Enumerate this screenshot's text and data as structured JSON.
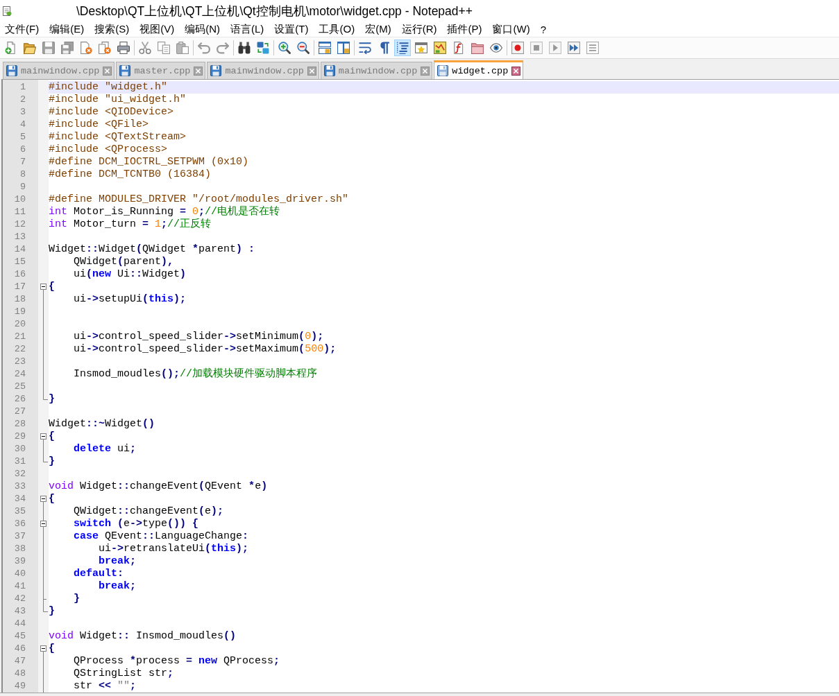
{
  "window": {
    "title": "\\Desktop\\QT上位机\\QT上位机\\Qt控制电机\\motor\\widget.cpp - Notepad++"
  },
  "menu": [
    "文件(F)",
    "编辑(E)",
    "搜索(S)",
    "视图(V)",
    "编码(N)",
    "语言(L)",
    "设置(T)",
    "工具(O)",
    "宏(M)",
    "运行(R)",
    "插件(P)",
    "窗口(W)",
    "?"
  ],
  "toolbar": [
    {
      "kind": "new-file",
      "pressed": false,
      "disabled": false
    },
    {
      "kind": "open",
      "pressed": false,
      "disabled": false
    },
    {
      "kind": "save",
      "pressed": false,
      "disabled": true
    },
    {
      "kind": "save-all",
      "pressed": false,
      "disabled": true
    },
    {
      "kind": "close",
      "pressed": false,
      "disabled": false
    },
    {
      "kind": "close-all",
      "pressed": false,
      "disabled": false
    },
    {
      "kind": "print",
      "pressed": false,
      "disabled": false
    },
    {
      "kind": "separator"
    },
    {
      "kind": "cut",
      "pressed": false,
      "disabled": true
    },
    {
      "kind": "copy",
      "pressed": false,
      "disabled": true
    },
    {
      "kind": "paste",
      "pressed": false,
      "disabled": true
    },
    {
      "kind": "separator"
    },
    {
      "kind": "undo",
      "pressed": false,
      "disabled": true
    },
    {
      "kind": "redo",
      "pressed": false,
      "disabled": true
    },
    {
      "kind": "separator"
    },
    {
      "kind": "find",
      "pressed": false,
      "disabled": false
    },
    {
      "kind": "replace",
      "pressed": false,
      "disabled": false
    },
    {
      "kind": "separator"
    },
    {
      "kind": "zoom-in",
      "pressed": false,
      "disabled": false
    },
    {
      "kind": "zoom-out",
      "pressed": false,
      "disabled": false
    },
    {
      "kind": "separator"
    },
    {
      "kind": "sync-vertical",
      "pressed": false,
      "disabled": false
    },
    {
      "kind": "sync-horizontal",
      "pressed": false,
      "disabled": false
    },
    {
      "kind": "separator"
    },
    {
      "kind": "word-wrap",
      "pressed": false,
      "disabled": false
    },
    {
      "kind": "show-all",
      "pressed": false,
      "disabled": false
    },
    {
      "kind": "indent-guide",
      "pressed": true,
      "disabled": false
    },
    {
      "kind": "user-language",
      "pressed": false,
      "disabled": false
    },
    {
      "kind": "document-map",
      "pressed": false,
      "disabled": false
    },
    {
      "kind": "function-list",
      "pressed": false,
      "disabled": false
    },
    {
      "kind": "folder-workspace",
      "pressed": false,
      "disabled": false
    },
    {
      "kind": "monitoring",
      "pressed": false,
      "disabled": false
    },
    {
      "kind": "separator"
    },
    {
      "kind": "record",
      "pressed": false,
      "disabled": false
    },
    {
      "kind": "stop",
      "pressed": false,
      "disabled": true
    },
    {
      "kind": "play",
      "pressed": false,
      "disabled": true
    },
    {
      "kind": "play-multiple",
      "pressed": false,
      "disabled": false
    },
    {
      "kind": "save-macro",
      "pressed": false,
      "disabled": true
    }
  ],
  "tabs": [
    {
      "label": "mainwindow.cpp",
      "selected": false
    },
    {
      "label": "master.cpp",
      "selected": false
    },
    {
      "label": "mainwindow.cpp",
      "selected": false
    },
    {
      "label": "mainwindow.cpp",
      "selected": false
    },
    {
      "label": "widget.cpp",
      "selected": true
    }
  ],
  "editor": {
    "lines": [
      {
        "number": "1",
        "current": true,
        "tokens": [
          {
            "kind": "pre",
            "text": "#include \"widget.h\""
          }
        ]
      },
      {
        "number": "2",
        "current": false,
        "tokens": [
          {
            "kind": "pre",
            "text": "#include \"ui_widget.h\""
          }
        ]
      },
      {
        "number": "3",
        "current": false,
        "tokens": [
          {
            "kind": "pre",
            "text": "#include <QIODevice>"
          }
        ]
      },
      {
        "number": "4",
        "current": false,
        "tokens": [
          {
            "kind": "pre",
            "text": "#include <QFile>"
          }
        ]
      },
      {
        "number": "5",
        "current": false,
        "tokens": [
          {
            "kind": "pre",
            "text": "#include <QTextStream>"
          }
        ]
      },
      {
        "number": "6",
        "current": false,
        "tokens": [
          {
            "kind": "pre",
            "text": "#include <QProcess>"
          }
        ]
      },
      {
        "number": "7",
        "current": false,
        "tokens": [
          {
            "kind": "pre",
            "text": "#define DCM_IOCTRL_SETPWM (0x10)"
          }
        ]
      },
      {
        "number": "8",
        "current": false,
        "tokens": [
          {
            "kind": "pre",
            "text": "#define DCM_TCNTB0 (16384)"
          }
        ]
      },
      {
        "number": "9",
        "current": false
      },
      {
        "number": "10",
        "current": false,
        "tokens": [
          {
            "kind": "pre",
            "text": "#define MODULES_DRIVER \"/root/modules_driver.sh\""
          }
        ]
      },
      {
        "number": "11",
        "current": false,
        "tokens": [
          {
            "kind": "type",
            "text": "int"
          },
          {
            "kind": "plain",
            "text": " Motor_is_Running "
          },
          {
            "kind": "operator",
            "text": "= "
          },
          {
            "kind": "number",
            "text": "0"
          },
          {
            "kind": "operator",
            "text": ";"
          },
          {
            "kind": "comment",
            "text": "//电机是否在转"
          }
        ]
      },
      {
        "number": "12",
        "current": false,
        "tokens": [
          {
            "kind": "type",
            "text": "int"
          },
          {
            "kind": "plain",
            "text": " Motor_turn "
          },
          {
            "kind": "operator",
            "text": "= "
          },
          {
            "kind": "number",
            "text": "1"
          },
          {
            "kind": "operator",
            "text": ";"
          },
          {
            "kind": "comment",
            "text": "//正反转"
          }
        ]
      },
      {
        "number": "13",
        "current": false
      },
      {
        "number": "14",
        "current": false,
        "tokens": [
          {
            "kind": "plain",
            "text": "Widget"
          },
          {
            "kind": "operator",
            "text": "::"
          },
          {
            "kind": "plain",
            "text": "Widget"
          },
          {
            "kind": "operator",
            "text": "("
          },
          {
            "kind": "plain",
            "text": "QWidget "
          },
          {
            "kind": "operator",
            "text": "*"
          },
          {
            "kind": "plain",
            "text": "parent"
          },
          {
            "kind": "operator",
            "text": ") :"
          }
        ]
      },
      {
        "number": "15",
        "current": false,
        "tokens": [
          {
            "kind": "plain",
            "text": "    QWidget"
          },
          {
            "kind": "operator",
            "text": "("
          },
          {
            "kind": "plain",
            "text": "parent"
          },
          {
            "kind": "operator",
            "text": "),"
          }
        ]
      },
      {
        "number": "16",
        "current": false,
        "tokens": [
          {
            "kind": "plain",
            "text": "    ui"
          },
          {
            "kind": "operator",
            "text": "("
          },
          {
            "kind": "keyword",
            "text": "new"
          },
          {
            "kind": "plain",
            "text": " Ui"
          },
          {
            "kind": "operator",
            "text": "::"
          },
          {
            "kind": "plain",
            "text": "Widget"
          },
          {
            "kind": "operator",
            "text": ")"
          }
        ]
      },
      {
        "number": "17",
        "current": false,
        "fold": {
          "kind": "expanded"
        },
        "tokens": [
          {
            "kind": "operator",
            "text": "{"
          }
        ]
      },
      {
        "number": "18",
        "current": false,
        "fold": {
          "kind": "line"
        },
        "tokens": [
          {
            "kind": "plain",
            "text": "    ui"
          },
          {
            "kind": "operator",
            "text": "->"
          },
          {
            "kind": "plain",
            "text": "setupUi"
          },
          {
            "kind": "operator",
            "text": "("
          },
          {
            "kind": "keyword",
            "text": "this"
          },
          {
            "kind": "operator",
            "text": ");"
          }
        ]
      },
      {
        "number": "19",
        "current": false,
        "fold": {
          "kind": "line"
        }
      },
      {
        "number": "20",
        "current": false,
        "fold": {
          "kind": "line"
        }
      },
      {
        "number": "21",
        "current": false,
        "fold": {
          "kind": "line"
        },
        "tokens": [
          {
            "kind": "plain",
            "text": "    ui"
          },
          {
            "kind": "operator",
            "text": "->"
          },
          {
            "kind": "plain",
            "text": "control_speed_slider"
          },
          {
            "kind": "operator",
            "text": "->"
          },
          {
            "kind": "plain",
            "text": "setMinimum"
          },
          {
            "kind": "operator",
            "text": "("
          },
          {
            "kind": "number",
            "text": "0"
          },
          {
            "kind": "operator",
            "text": ");"
          }
        ]
      },
      {
        "number": "22",
        "current": false,
        "fold": {
          "kind": "line"
        },
        "tokens": [
          {
            "kind": "plain",
            "text": "    ui"
          },
          {
            "kind": "operator",
            "text": "->"
          },
          {
            "kind": "plain",
            "text": "control_speed_slider"
          },
          {
            "kind": "operator",
            "text": "->"
          },
          {
            "kind": "plain",
            "text": "setMaximum"
          },
          {
            "kind": "operator",
            "text": "("
          },
          {
            "kind": "number",
            "text": "500"
          },
          {
            "kind": "operator",
            "text": ");"
          }
        ]
      },
      {
        "number": "23",
        "current": false,
        "fold": {
          "kind": "line"
        }
      },
      {
        "number": "24",
        "current": false,
        "fold": {
          "kind": "line"
        },
        "tokens": [
          {
            "kind": "plain",
            "text": "    Insmod_moudles"
          },
          {
            "kind": "operator",
            "text": "();"
          },
          {
            "kind": "comment",
            "text": "//加载模块硬件驱动脚本程序"
          }
        ]
      },
      {
        "number": "25",
        "current": false,
        "fold": {
          "kind": "line"
        }
      },
      {
        "number": "26",
        "current": false,
        "fold": {
          "kind": "end"
        },
        "tokens": [
          {
            "kind": "operator",
            "text": "}"
          }
        ]
      },
      {
        "number": "27",
        "current": false
      },
      {
        "number": "28",
        "current": false,
        "tokens": [
          {
            "kind": "plain",
            "text": "Widget"
          },
          {
            "kind": "operator",
            "text": "::~"
          },
          {
            "kind": "plain",
            "text": "Widget"
          },
          {
            "kind": "operator",
            "text": "()"
          }
        ]
      },
      {
        "number": "29",
        "current": false,
        "fold": {
          "kind": "expanded"
        },
        "tokens": [
          {
            "kind": "operator",
            "text": "{"
          }
        ]
      },
      {
        "number": "30",
        "current": false,
        "fold": {
          "kind": "line"
        },
        "tokens": [
          {
            "kind": "keyword",
            "text": "    delete"
          },
          {
            "kind": "plain",
            "text": " ui"
          },
          {
            "kind": "operator",
            "text": ";"
          }
        ]
      },
      {
        "number": "31",
        "current": false,
        "fold": {
          "kind": "end"
        },
        "tokens": [
          {
            "kind": "operator",
            "text": "}"
          }
        ]
      },
      {
        "number": "32",
        "current": false
      },
      {
        "number": "33",
        "current": false,
        "tokens": [
          {
            "kind": "type",
            "text": "void"
          },
          {
            "kind": "plain",
            "text": " Widget"
          },
          {
            "kind": "operator",
            "text": "::"
          },
          {
            "kind": "plain",
            "text": "changeEvent"
          },
          {
            "kind": "operator",
            "text": "("
          },
          {
            "kind": "plain",
            "text": "QEvent "
          },
          {
            "kind": "operator",
            "text": "*"
          },
          {
            "kind": "plain",
            "text": "e"
          },
          {
            "kind": "operator",
            "text": ")"
          }
        ]
      },
      {
        "number": "34",
        "current": false,
        "fold": {
          "kind": "expanded"
        },
        "tokens": [
          {
            "kind": "operator",
            "text": "{"
          }
        ]
      },
      {
        "number": "35",
        "current": false,
        "fold": {
          "kind": "line"
        },
        "tokens": [
          {
            "kind": "plain",
            "text": "    QWidget"
          },
          {
            "kind": "operator",
            "text": "::"
          },
          {
            "kind": "plain",
            "text": "changeEvent"
          },
          {
            "kind": "operator",
            "text": "("
          },
          {
            "kind": "plain",
            "text": "e"
          },
          {
            "kind": "operator",
            "text": ");"
          }
        ]
      },
      {
        "number": "36",
        "current": false,
        "fold": {
          "kind": "expanded"
        },
        "tokens": [
          {
            "kind": "keyword",
            "text": "    switch"
          },
          {
            "kind": "operator",
            "text": " ("
          },
          {
            "kind": "plain",
            "text": "e"
          },
          {
            "kind": "operator",
            "text": "->"
          },
          {
            "kind": "plain",
            "text": "type"
          },
          {
            "kind": "operator",
            "text": "()) {"
          }
        ]
      },
      {
        "number": "37",
        "current": false,
        "fold": {
          "kind": "line"
        },
        "tokens": [
          {
            "kind": "keyword",
            "text": "    case"
          },
          {
            "kind": "plain",
            "text": " QEvent"
          },
          {
            "kind": "operator",
            "text": "::"
          },
          {
            "kind": "plain",
            "text": "LanguageChange"
          },
          {
            "kind": "operator",
            "text": ":"
          }
        ]
      },
      {
        "number": "38",
        "current": false,
        "fold": {
          "kind": "line"
        },
        "tokens": [
          {
            "kind": "plain",
            "text": "        ui"
          },
          {
            "kind": "operator",
            "text": "->"
          },
          {
            "kind": "plain",
            "text": "retranslateUi"
          },
          {
            "kind": "operator",
            "text": "("
          },
          {
            "kind": "keyword",
            "text": "this"
          },
          {
            "kind": "operator",
            "text": ");"
          }
        ]
      },
      {
        "number": "39",
        "current": false,
        "fold": {
          "kind": "line"
        },
        "tokens": [
          {
            "kind": "keyword",
            "text": "        break"
          },
          {
            "kind": "operator",
            "text": ";"
          }
        ]
      },
      {
        "number": "40",
        "current": false,
        "fold": {
          "kind": "line"
        },
        "tokens": [
          {
            "kind": "keyword",
            "text": "    default"
          },
          {
            "kind": "operator",
            "text": ":"
          }
        ]
      },
      {
        "number": "41",
        "current": false,
        "fold": {
          "kind": "line"
        },
        "tokens": [
          {
            "kind": "keyword",
            "text": "        break"
          },
          {
            "kind": "operator",
            "text": ";"
          }
        ]
      },
      {
        "number": "42",
        "current": false,
        "fold": {
          "kind": "tee"
        },
        "tokens": [
          {
            "kind": "operator",
            "text": "    }"
          }
        ]
      },
      {
        "number": "43",
        "current": false,
        "fold": {
          "kind": "end"
        },
        "tokens": [
          {
            "kind": "operator",
            "text": "}"
          }
        ]
      },
      {
        "number": "44",
        "current": false
      },
      {
        "number": "45",
        "current": false,
        "tokens": [
          {
            "kind": "type",
            "text": "void"
          },
          {
            "kind": "plain",
            "text": " Widget"
          },
          {
            "kind": "operator",
            "text": "::"
          },
          {
            "kind": "plain",
            "text": " Insmod_moudles"
          },
          {
            "kind": "operator",
            "text": "()"
          }
        ]
      },
      {
        "number": "46",
        "current": false,
        "fold": {
          "kind": "expanded"
        },
        "tokens": [
          {
            "kind": "operator",
            "text": "{"
          }
        ]
      },
      {
        "number": "47",
        "current": false,
        "fold": {
          "kind": "line"
        },
        "tokens": [
          {
            "kind": "plain",
            "text": "    QProcess "
          },
          {
            "kind": "operator",
            "text": "*"
          },
          {
            "kind": "plain",
            "text": "process "
          },
          {
            "kind": "operator",
            "text": "= "
          },
          {
            "kind": "keyword",
            "text": "new"
          },
          {
            "kind": "plain",
            "text": " QProcess"
          },
          {
            "kind": "operator",
            "text": ";"
          }
        ]
      },
      {
        "number": "48",
        "current": false,
        "fold": {
          "kind": "line"
        },
        "tokens": [
          {
            "kind": "plain",
            "text": "    QStringList str"
          },
          {
            "kind": "operator",
            "text": ";"
          }
        ]
      },
      {
        "number": "49",
        "current": false,
        "fold": {
          "kind": "line"
        },
        "tokens": [
          {
            "kind": "plain",
            "text": "    str "
          },
          {
            "kind": "operator",
            "text": "<< "
          },
          {
            "kind": "string",
            "text": "\"\""
          },
          {
            "kind": "operator",
            "text": ";"
          }
        ]
      }
    ]
  }
}
